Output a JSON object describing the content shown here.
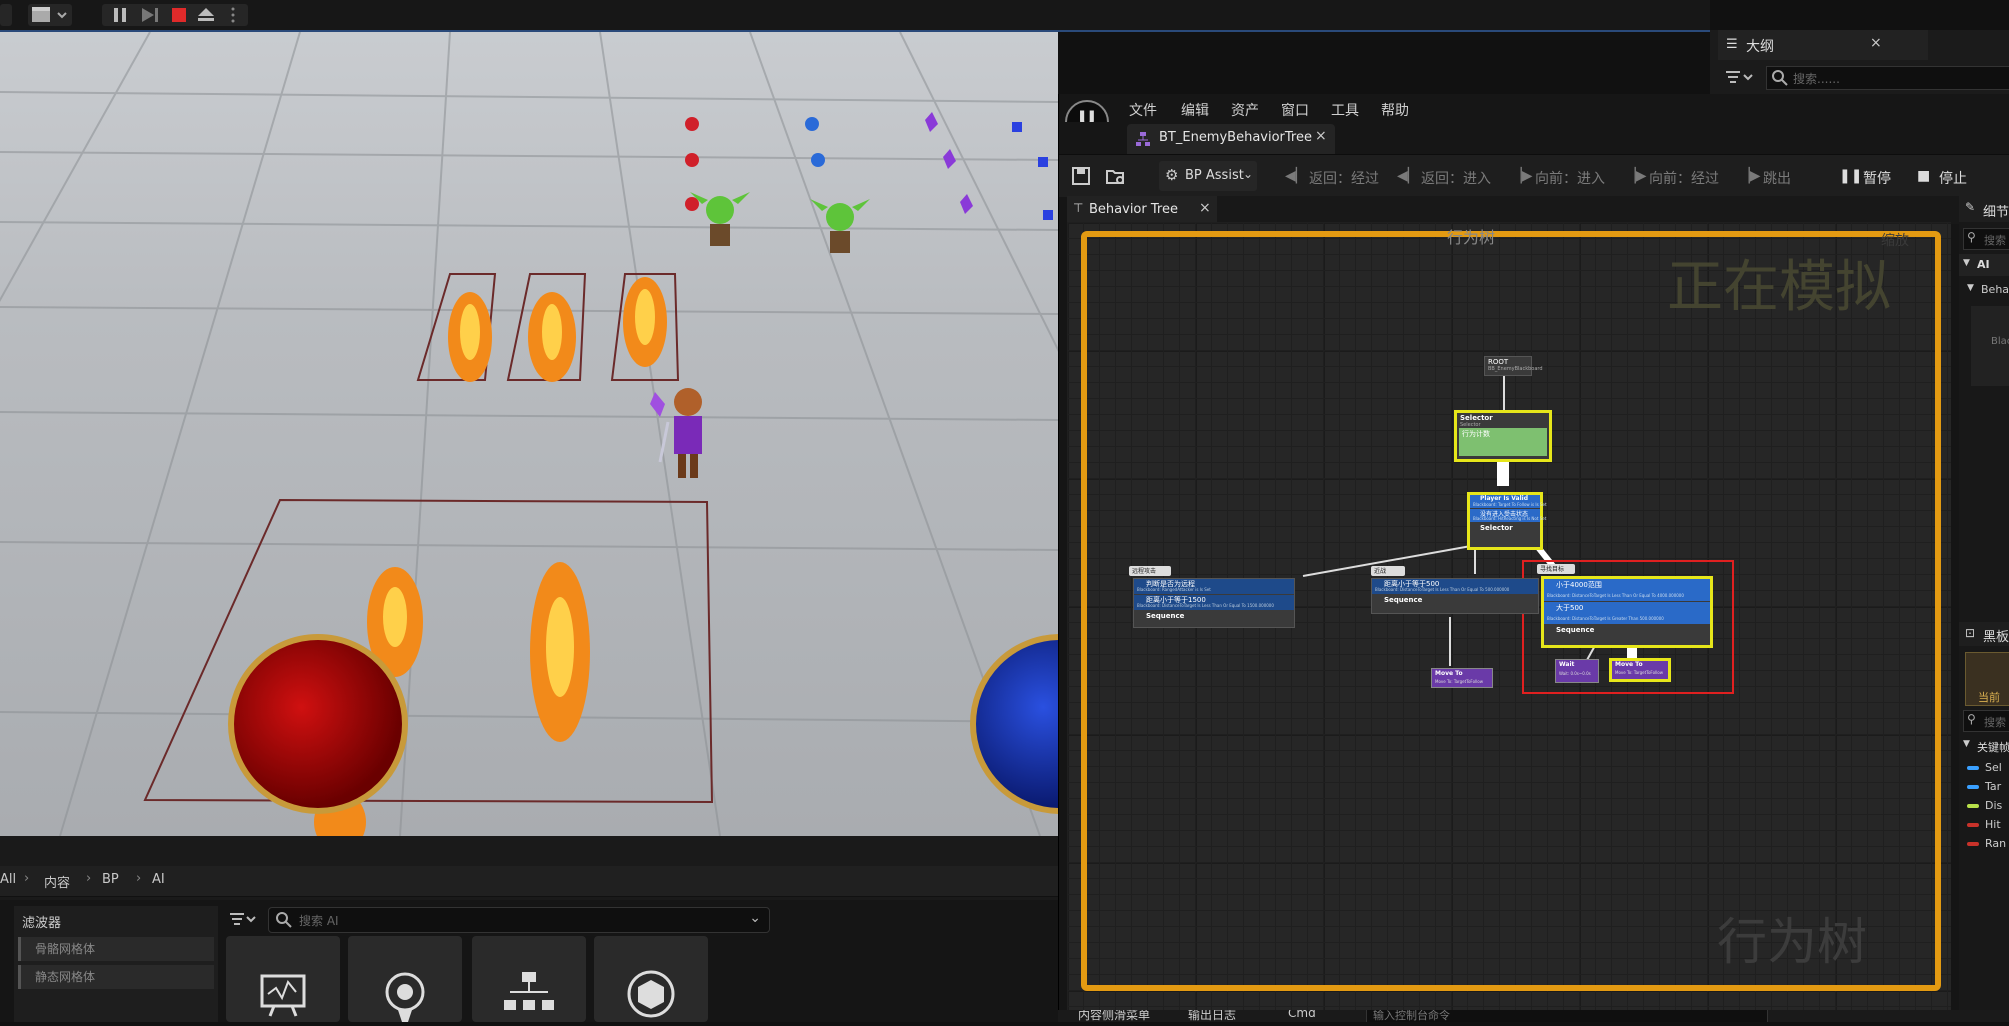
{
  "content_browser": {
    "breadcrumbs": [
      "All",
      "内容",
      "BP",
      "AI"
    ],
    "filters_title": "滤波器",
    "filters": [
      "骨骼网格体",
      "静态网格体"
    ],
    "search_placeholder": "搜索 AI"
  },
  "outliner": {
    "title": "大纲",
    "search_placeholder": "搜索......"
  },
  "bt_editor": {
    "menu": [
      "文件",
      "编辑",
      "资产",
      "窗口",
      "工具",
      "帮助"
    ],
    "asset_tab": "BT_EnemyBehaviorTree",
    "toolbar": {
      "bp_assist": "BP Assist",
      "back_over": "返回：经过",
      "back_into": "返回：进入",
      "fwd_into": "向前：进入",
      "fwd_over": "向前：经过",
      "step_out": "跳出",
      "pause": "暂停",
      "stop": "停止"
    },
    "graph_tab": "Behavior Tree",
    "graph_title": "行为树",
    "zoom_text": "缩放",
    "simulating_label": "正在模拟",
    "watermark": "行为树",
    "nodes": {
      "root_title": "ROOT",
      "root_sub": "BB_EnemyBlackboard",
      "selector_title": "Selector",
      "selector_sub": "Selector",
      "selector_dec1": "行为计数",
      "mid_dec1": "Player Is Valid",
      "mid_dec1_sub": "Blackboard: Target To Follow is Is Set",
      "mid_dec2": "没有进入受击状态",
      "mid_dec2_sub": "Blackboard: HitReacting is Is Not Set",
      "mid_selector": "Selector",
      "left_comment": "远程攻击",
      "left_dec1": "判断是否为远程",
      "left_dec1_sub": "Blackboard: RangedAttacker is Is Set",
      "left_dec2": "距离小于等于1500",
      "left_dec2_sub": "Blackboard: DistanceToTarget Is Less Than Or Equal To 1500.000000",
      "left_seq": "Sequence",
      "center_comment": "近战",
      "center_dec": "距离小于等于500",
      "center_dec_sub": "Blackboard: DistanceToTarget Is Less Than Or Equal To 500.000000",
      "center_seq": "Sequence",
      "center_moveto": "Move To",
      "center_moveto_sub": "Move To: TargetToFollow",
      "right_comment": "寻找目标",
      "right_dec1": "小于4000范围",
      "right_dec1_sub": "Blackboard: DistanceToTarget Is Less Than Or Equal To 4000.000000",
      "right_dec2": "大于500",
      "right_dec2_sub": "Blackboard: DistanceToTarget Is Greater Than 500.000000",
      "right_seq": "Sequence",
      "wait": "Wait",
      "wait_sub": "Wait: 0.0s~0.0s",
      "right_moveto": "Move To",
      "right_moveto_sub": "Move To: TargetToFollow"
    }
  },
  "right_dock": {
    "details": "细节",
    "search": "搜索",
    "ai": "AI",
    "behavior": "Behavi",
    "bla": "Blac",
    "blackboard": "黑板",
    "current": "当前",
    "search2": "搜索",
    "keys": "关键帧",
    "key_items": [
      "Sel",
      "Tar",
      "Dis",
      "Hit",
      "Ran"
    ],
    "key_colors": [
      "#3aa0ff",
      "#3aa0ff",
      "#b8e04a",
      "#c8322a",
      "#c8322a"
    ]
  },
  "bottom_bar": {
    "content_drawer": "内容侧滑菜单",
    "output_log": "输出日志",
    "cmd": "Cmd",
    "console_placeholder": "输入控制台命令"
  },
  "colors": {
    "simulating_frame": "#e39a12",
    "highlight_box": "#e02020",
    "selected_outline": "#e6e61a"
  }
}
